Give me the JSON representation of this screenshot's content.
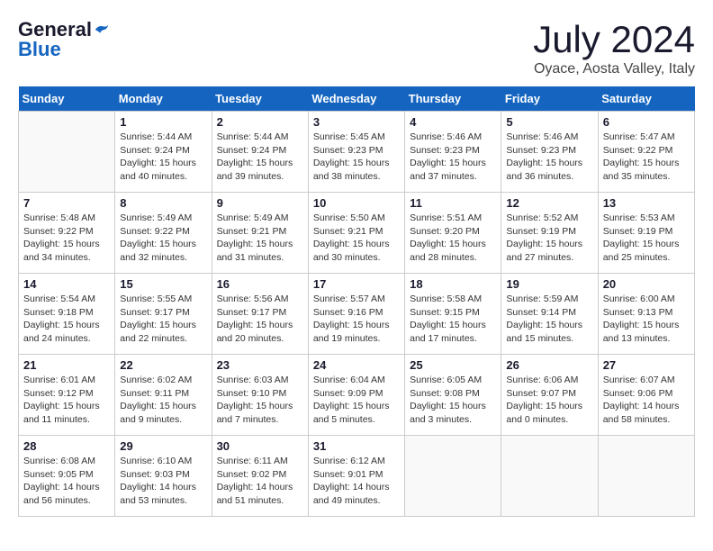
{
  "logo": {
    "general": "General",
    "blue": "Blue"
  },
  "header": {
    "month_year": "July 2024",
    "location": "Oyace, Aosta Valley, Italy"
  },
  "weekdays": [
    "Sunday",
    "Monday",
    "Tuesday",
    "Wednesday",
    "Thursday",
    "Friday",
    "Saturday"
  ],
  "weeks": [
    [
      {
        "day": "",
        "sunrise": "",
        "sunset": "",
        "daylight": ""
      },
      {
        "day": "1",
        "sunrise": "Sunrise: 5:44 AM",
        "sunset": "Sunset: 9:24 PM",
        "daylight": "Daylight: 15 hours and 40 minutes."
      },
      {
        "day": "2",
        "sunrise": "Sunrise: 5:44 AM",
        "sunset": "Sunset: 9:24 PM",
        "daylight": "Daylight: 15 hours and 39 minutes."
      },
      {
        "day": "3",
        "sunrise": "Sunrise: 5:45 AM",
        "sunset": "Sunset: 9:23 PM",
        "daylight": "Daylight: 15 hours and 38 minutes."
      },
      {
        "day": "4",
        "sunrise": "Sunrise: 5:46 AM",
        "sunset": "Sunset: 9:23 PM",
        "daylight": "Daylight: 15 hours and 37 minutes."
      },
      {
        "day": "5",
        "sunrise": "Sunrise: 5:46 AM",
        "sunset": "Sunset: 9:23 PM",
        "daylight": "Daylight: 15 hours and 36 minutes."
      },
      {
        "day": "6",
        "sunrise": "Sunrise: 5:47 AM",
        "sunset": "Sunset: 9:22 PM",
        "daylight": "Daylight: 15 hours and 35 minutes."
      }
    ],
    [
      {
        "day": "7",
        "sunrise": "Sunrise: 5:48 AM",
        "sunset": "Sunset: 9:22 PM",
        "daylight": "Daylight: 15 hours and 34 minutes."
      },
      {
        "day": "8",
        "sunrise": "Sunrise: 5:49 AM",
        "sunset": "Sunset: 9:22 PM",
        "daylight": "Daylight: 15 hours and 32 minutes."
      },
      {
        "day": "9",
        "sunrise": "Sunrise: 5:49 AM",
        "sunset": "Sunset: 9:21 PM",
        "daylight": "Daylight: 15 hours and 31 minutes."
      },
      {
        "day": "10",
        "sunrise": "Sunrise: 5:50 AM",
        "sunset": "Sunset: 9:21 PM",
        "daylight": "Daylight: 15 hours and 30 minutes."
      },
      {
        "day": "11",
        "sunrise": "Sunrise: 5:51 AM",
        "sunset": "Sunset: 9:20 PM",
        "daylight": "Daylight: 15 hours and 28 minutes."
      },
      {
        "day": "12",
        "sunrise": "Sunrise: 5:52 AM",
        "sunset": "Sunset: 9:19 PM",
        "daylight": "Daylight: 15 hours and 27 minutes."
      },
      {
        "day": "13",
        "sunrise": "Sunrise: 5:53 AM",
        "sunset": "Sunset: 9:19 PM",
        "daylight": "Daylight: 15 hours and 25 minutes."
      }
    ],
    [
      {
        "day": "14",
        "sunrise": "Sunrise: 5:54 AM",
        "sunset": "Sunset: 9:18 PM",
        "daylight": "Daylight: 15 hours and 24 minutes."
      },
      {
        "day": "15",
        "sunrise": "Sunrise: 5:55 AM",
        "sunset": "Sunset: 9:17 PM",
        "daylight": "Daylight: 15 hours and 22 minutes."
      },
      {
        "day": "16",
        "sunrise": "Sunrise: 5:56 AM",
        "sunset": "Sunset: 9:17 PM",
        "daylight": "Daylight: 15 hours and 20 minutes."
      },
      {
        "day": "17",
        "sunrise": "Sunrise: 5:57 AM",
        "sunset": "Sunset: 9:16 PM",
        "daylight": "Daylight: 15 hours and 19 minutes."
      },
      {
        "day": "18",
        "sunrise": "Sunrise: 5:58 AM",
        "sunset": "Sunset: 9:15 PM",
        "daylight": "Daylight: 15 hours and 17 minutes."
      },
      {
        "day": "19",
        "sunrise": "Sunrise: 5:59 AM",
        "sunset": "Sunset: 9:14 PM",
        "daylight": "Daylight: 15 hours and 15 minutes."
      },
      {
        "day": "20",
        "sunrise": "Sunrise: 6:00 AM",
        "sunset": "Sunset: 9:13 PM",
        "daylight": "Daylight: 15 hours and 13 minutes."
      }
    ],
    [
      {
        "day": "21",
        "sunrise": "Sunrise: 6:01 AM",
        "sunset": "Sunset: 9:12 PM",
        "daylight": "Daylight: 15 hours and 11 minutes."
      },
      {
        "day": "22",
        "sunrise": "Sunrise: 6:02 AM",
        "sunset": "Sunset: 9:11 PM",
        "daylight": "Daylight: 15 hours and 9 minutes."
      },
      {
        "day": "23",
        "sunrise": "Sunrise: 6:03 AM",
        "sunset": "Sunset: 9:10 PM",
        "daylight": "Daylight: 15 hours and 7 minutes."
      },
      {
        "day": "24",
        "sunrise": "Sunrise: 6:04 AM",
        "sunset": "Sunset: 9:09 PM",
        "daylight": "Daylight: 15 hours and 5 minutes."
      },
      {
        "day": "25",
        "sunrise": "Sunrise: 6:05 AM",
        "sunset": "Sunset: 9:08 PM",
        "daylight": "Daylight: 15 hours and 3 minutes."
      },
      {
        "day": "26",
        "sunrise": "Sunrise: 6:06 AM",
        "sunset": "Sunset: 9:07 PM",
        "daylight": "Daylight: 15 hours and 0 minutes."
      },
      {
        "day": "27",
        "sunrise": "Sunrise: 6:07 AM",
        "sunset": "Sunset: 9:06 PM",
        "daylight": "Daylight: 14 hours and 58 minutes."
      }
    ],
    [
      {
        "day": "28",
        "sunrise": "Sunrise: 6:08 AM",
        "sunset": "Sunset: 9:05 PM",
        "daylight": "Daylight: 14 hours and 56 minutes."
      },
      {
        "day": "29",
        "sunrise": "Sunrise: 6:10 AM",
        "sunset": "Sunset: 9:03 PM",
        "daylight": "Daylight: 14 hours and 53 minutes."
      },
      {
        "day": "30",
        "sunrise": "Sunrise: 6:11 AM",
        "sunset": "Sunset: 9:02 PM",
        "daylight": "Daylight: 14 hours and 51 minutes."
      },
      {
        "day": "31",
        "sunrise": "Sunrise: 6:12 AM",
        "sunset": "Sunset: 9:01 PM",
        "daylight": "Daylight: 14 hours and 49 minutes."
      },
      {
        "day": "",
        "sunrise": "",
        "sunset": "",
        "daylight": ""
      },
      {
        "day": "",
        "sunrise": "",
        "sunset": "",
        "daylight": ""
      },
      {
        "day": "",
        "sunrise": "",
        "sunset": "",
        "daylight": ""
      }
    ]
  ]
}
